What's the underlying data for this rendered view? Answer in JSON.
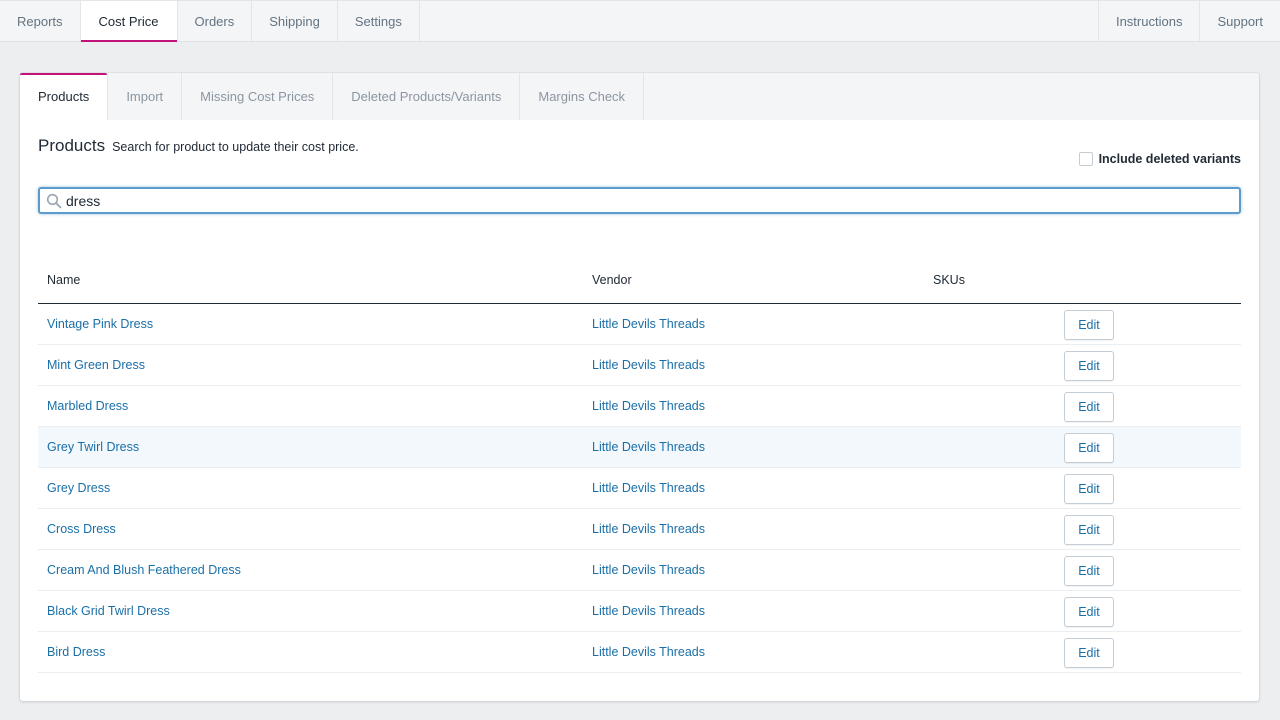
{
  "topnav": {
    "left_tabs": [
      "Reports",
      "Cost Price",
      "Orders",
      "Shipping",
      "Settings"
    ],
    "active_tab": "Cost Price",
    "right_tabs": [
      "Instructions",
      "Support"
    ]
  },
  "subtabs": {
    "items": [
      "Products",
      "Import",
      "Missing Cost Prices",
      "Deleted Products/Variants",
      "Margins Check"
    ],
    "active": "Products"
  },
  "page": {
    "title": "Products",
    "subtitle": "Search for product to update their cost price.",
    "include_deleted_label": "Include deleted variants",
    "include_deleted_checked": false
  },
  "search": {
    "value": "dress",
    "icon": "search-icon"
  },
  "table": {
    "headers": {
      "name": "Name",
      "vendor": "Vendor",
      "skus": "SKUs"
    },
    "edit_label": "Edit",
    "rows": [
      {
        "name": "Vintage Pink Dress",
        "vendor": "Little Devils Threads"
      },
      {
        "name": "Mint Green Dress",
        "vendor": "Little Devils Threads"
      },
      {
        "name": "Marbled Dress",
        "vendor": "Little Devils Threads"
      },
      {
        "name": "Grey Twirl Dress",
        "vendor": "Little Devils Threads"
      },
      {
        "name": "Grey Dress",
        "vendor": "Little Devils Threads"
      },
      {
        "name": "Cross Dress",
        "vendor": "Little Devils Threads"
      },
      {
        "name": "Cream And Blush Feathered Dress",
        "vendor": "Little Devils Threads"
      },
      {
        "name": "Black Grid Twirl Dress",
        "vendor": "Little Devils Threads"
      },
      {
        "name": "Bird Dress",
        "vendor": "Little Devils Threads"
      }
    ],
    "highlighted_row": "Grey Twirl Dress"
  },
  "colors": {
    "accent": "#c4127b",
    "link": "#1a6fa8",
    "focus": "#5c9ccc"
  }
}
